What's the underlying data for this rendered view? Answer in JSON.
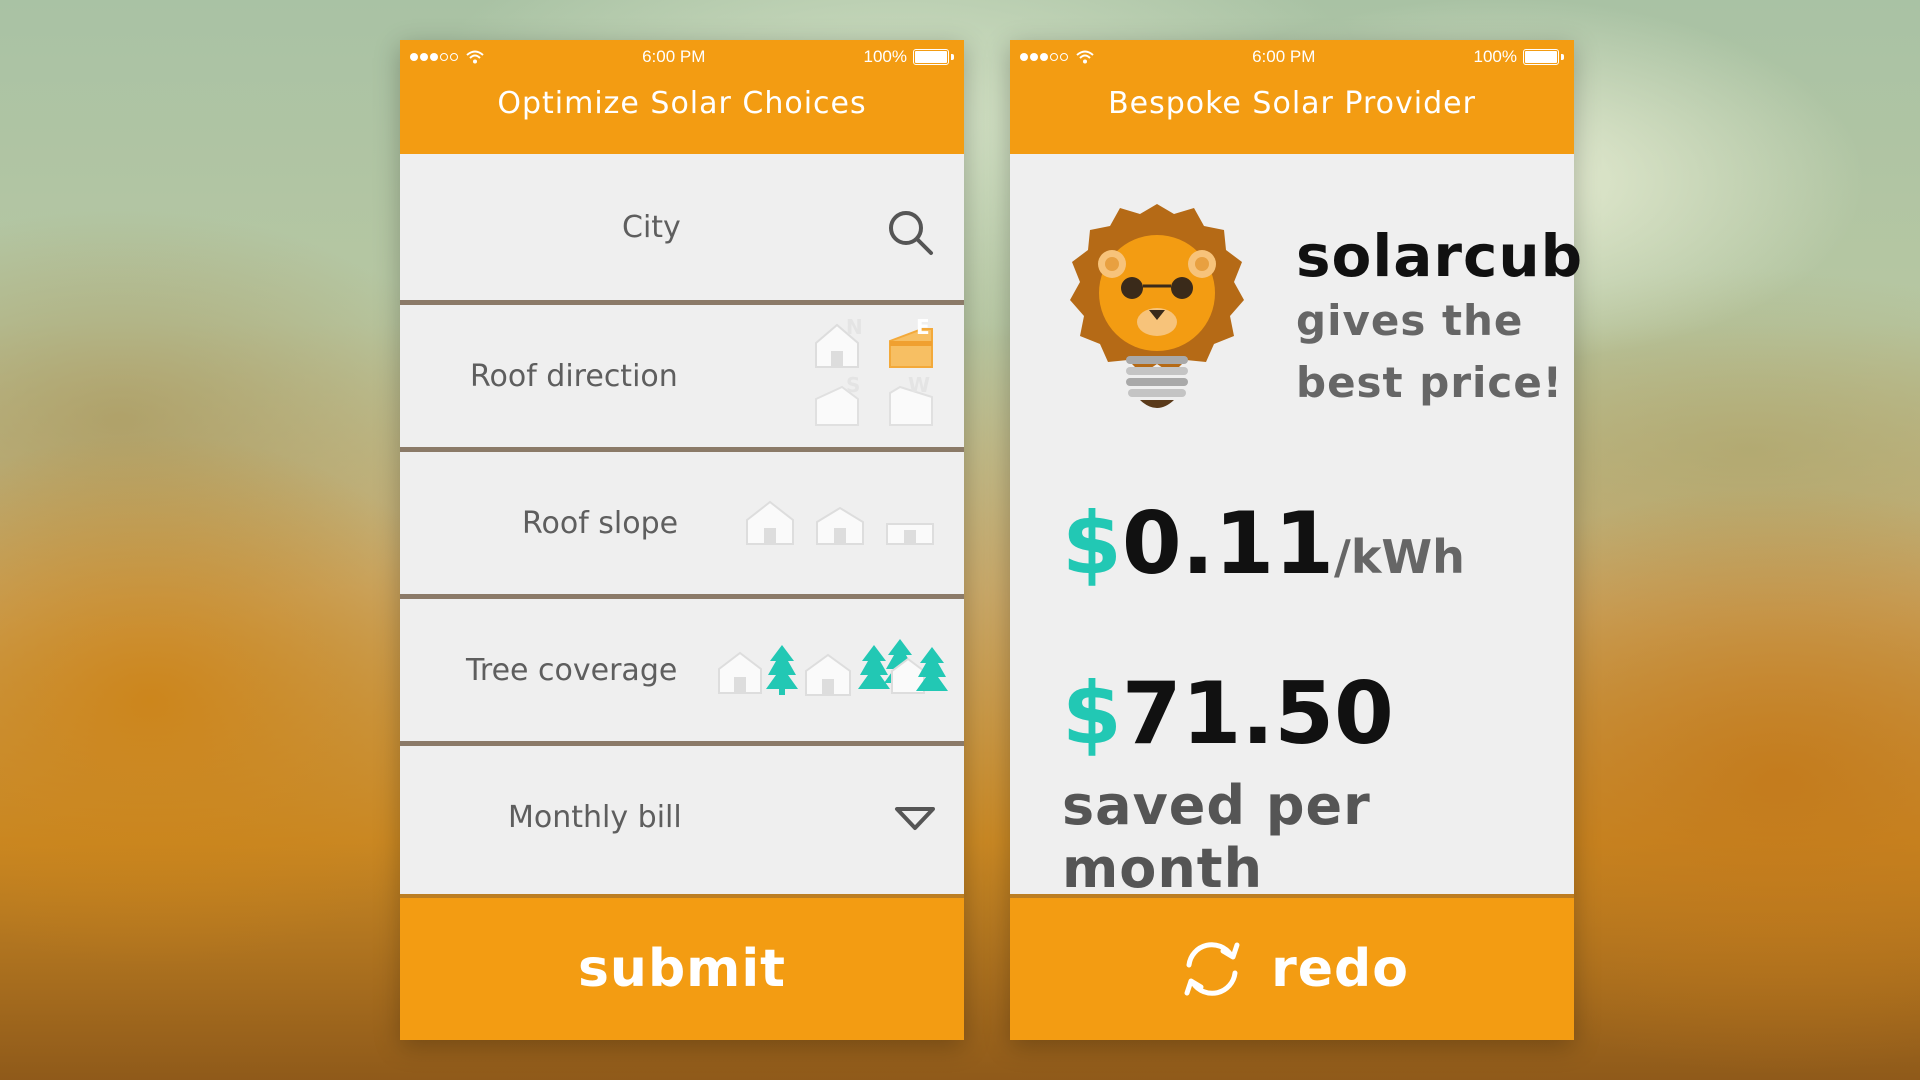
{
  "status_bar": {
    "time": "6:00 PM",
    "battery": "100%"
  },
  "left_screen": {
    "title": "Optimize Solar Choices",
    "fields": {
      "city": {
        "label": "City",
        "icon": "search-icon"
      },
      "roof_direction": {
        "label": "Roof direction",
        "options": [
          "N",
          "E",
          "S",
          "W"
        ],
        "selected": "E"
      },
      "roof_slope": {
        "label": "Roof slope"
      },
      "tree_coverage": {
        "label": "Tree coverage"
      },
      "monthly_bill": {
        "label": "Monthly bill",
        "icon": "dropdown-triangle-icon"
      }
    },
    "submit_label": "submit"
  },
  "right_screen": {
    "title": "Bespoke Solar Provider",
    "provider": {
      "name": "solarcub",
      "line1": "gives the",
      "line2": "best price!",
      "icon": "lion-bulb-logo"
    },
    "rate": {
      "currency": "$",
      "value": "0.11",
      "unit": "/kWh"
    },
    "savings": {
      "currency": "$",
      "value": "71.50",
      "label": "saved per month"
    },
    "redo_label": "redo"
  },
  "colors": {
    "accent": "#f39c12",
    "teal": "#22c8b4",
    "panel": "#efefef",
    "divider": "#8b7a68"
  }
}
